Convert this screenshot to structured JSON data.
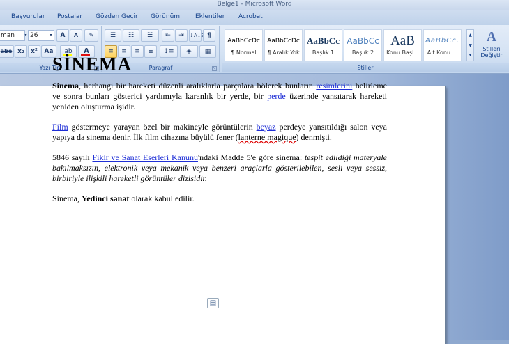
{
  "window": {
    "title": "Belge1 - Microsoft Word"
  },
  "tabs": [
    "Başvurular",
    "Postalar",
    "Gözden Geçir",
    "Görünüm",
    "Eklentiler",
    "Acrobat"
  ],
  "font_group": {
    "font_name": "man",
    "font_size": "26",
    "grow_label": "A",
    "shrink_label": "A",
    "strike_label": "abe",
    "subscript_label": "x₂",
    "superscript_label": "x²",
    "case_label": "Aa",
    "highlight_label": "ab",
    "color_label": "A",
    "label": "Yazı Tipi"
  },
  "paragraph_group": {
    "label": "Paragraf",
    "pilcrow": "¶",
    "sort": "↓A↓Z"
  },
  "styles_group": {
    "label": "Stiller",
    "items": [
      {
        "sample": "AaBbCcDc",
        "name": "¶ Normal"
      },
      {
        "sample": "AaBbCcDc",
        "name": "¶ Aralık Yok"
      },
      {
        "sample": "AaBbCc",
        "name": "Başlık 1"
      },
      {
        "sample": "AaBbCc",
        "name": "Başlık 2"
      },
      {
        "sample": "AaB",
        "name": "Konu Başl..."
      },
      {
        "sample": "AaBbCc.",
        "name": "Alt Konu ..."
      }
    ],
    "change_styles_label_1": "Stilleri",
    "change_styles_label_2": "Değiştir"
  },
  "document": {
    "heading": "SİNEMA",
    "p1": {
      "bold": "Sinema",
      "t1": ", herhangi bir hareketi düzenli aralıklarla parçalara bölerek bunların ",
      "link1": "resimlerini",
      "t2": " belirleme ve sonra bunları gösterici yardımıyla karanlık bir yerde, bir ",
      "link2": "perde",
      "t3": " üzerinde yansıtarak hareketi yeniden oluşturma işidir."
    },
    "p2": {
      "link1": "Film",
      "t1": " göstermeye yarayan özel bir makineyle görüntülerin ",
      "link2": "beyaz",
      "t2": " perdeye yansıtıldığı salon veya yapıya da sinema denir. İlk film cihazına büyülü fener (",
      "wavy": "lanterne magique",
      "t3": ") denmişti."
    },
    "p3": {
      "t1": "5846 sayılı ",
      "link1": "Fikir ve Sanat Eserleri Kanunu",
      "t2": "'ndaki Madde 5'e göre sinema: ",
      "italic": "tespit edildiği materyale bakılmaksızın, elektronik veya mekanik veya benzeri araçlarla gösterilebilen, sesli veya sessiz, birbiriyle ilişkili hareketli görüntüler dizisidir."
    },
    "p4": {
      "t1": "Sinema, ",
      "bold": "Yedinci sanat",
      "t2": " olarak kabul edilir."
    }
  },
  "colors": {
    "link": "#1f2fd6",
    "ribbon_text": "#15428b",
    "font_color_bar": "#e01010",
    "highlight_bar": "#ffff00"
  }
}
